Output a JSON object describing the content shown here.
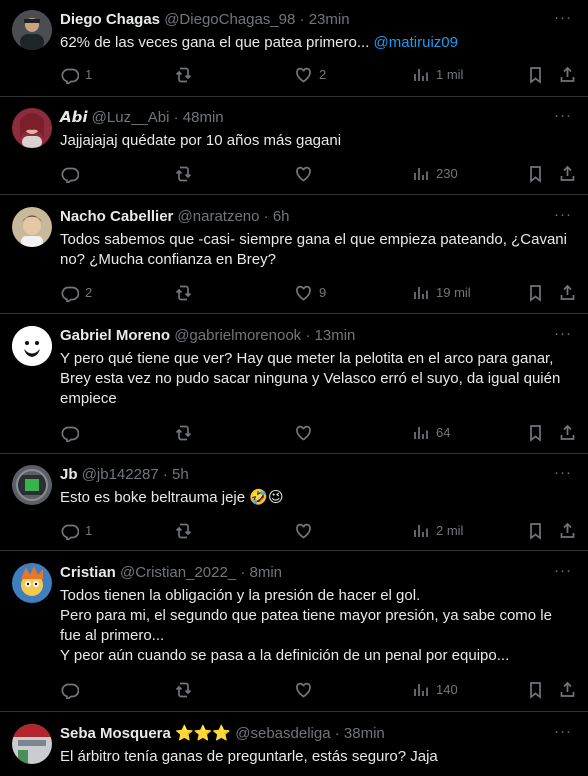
{
  "tweets": [
    {
      "name": "Diego Chagas",
      "handle": "@DiegoChagas_98",
      "sep": "·",
      "time": "23min",
      "text": "62% de las veces gana el que patea primero...",
      "mention": "@matiruiz09",
      "replies": "1",
      "retweets": "",
      "likes": "2",
      "views": "1 mil"
    },
    {
      "name": "𝘼𝙗𝙞",
      "handle": "@Luz__Abi",
      "sep": "·",
      "time": "48min",
      "text": "Jajjajajaj quédate por 10 años más gagani",
      "replies": "",
      "retweets": "",
      "likes": "",
      "views": "230"
    },
    {
      "name": "Nacho Cabellier",
      "handle": "@naratzeno",
      "sep": "·",
      "time": "6h",
      "text": "Todos sabemos que -casi- siempre gana el que empieza pateando, ¿Cavani\nno? ¿Mucha confianza en Brey?",
      "replies": "2",
      "retweets": "",
      "likes": "9",
      "views": "19 mil"
    },
    {
      "name": "Gabriel Moreno",
      "handle": "@gabrielmorenook",
      "sep": "·",
      "time": "13min",
      "text": "Y pero qué tiene que ver? Hay que meter la pelotita en el arco para ganar,\nBrey esta vez no pudo sacar ninguna y Velasco erró el suyo, da igual quién\nempiece",
      "replies": "",
      "retweets": "",
      "likes": "",
      "views": "64"
    },
    {
      "name": "Jb",
      "handle": "@jb142287",
      "sep": "·",
      "time": "5h",
      "text": "Esto es boke beltrauma jeje 🤣😉",
      "replies": "1",
      "retweets": "",
      "likes": "",
      "views": "2 mil"
    },
    {
      "name": "Cristian",
      "handle": "@Cristian_2022_",
      "sep": "·",
      "time": "8min",
      "text": "Todos tienen la obligación y la presión de hacer el gol.\nPero para mi, el segundo que patea tiene mayor presión, ya sabe como le\nfue al primero...\nY peor aún cuando se pasa a la definición de un penal por equipo...",
      "replies": "",
      "retweets": "",
      "likes": "",
      "views": "140"
    },
    {
      "name": "Seba Mosquera ⭐⭐⭐",
      "handle": "@sebasdeliga",
      "sep": "·",
      "time": "38min",
      "text": "El árbitro tenía ganas de preguntarle, estás seguro? Jaja"
    }
  ],
  "colors": {
    "background": "#000000",
    "text": "#e7e9ea",
    "muted": "#71767b",
    "link": "#1d9bf0",
    "divider": "#2f3336"
  },
  "icons": [
    "reply-icon",
    "retweet-icon",
    "like-icon",
    "views-icon",
    "bookmark-icon",
    "share-icon",
    "more-icon"
  ]
}
